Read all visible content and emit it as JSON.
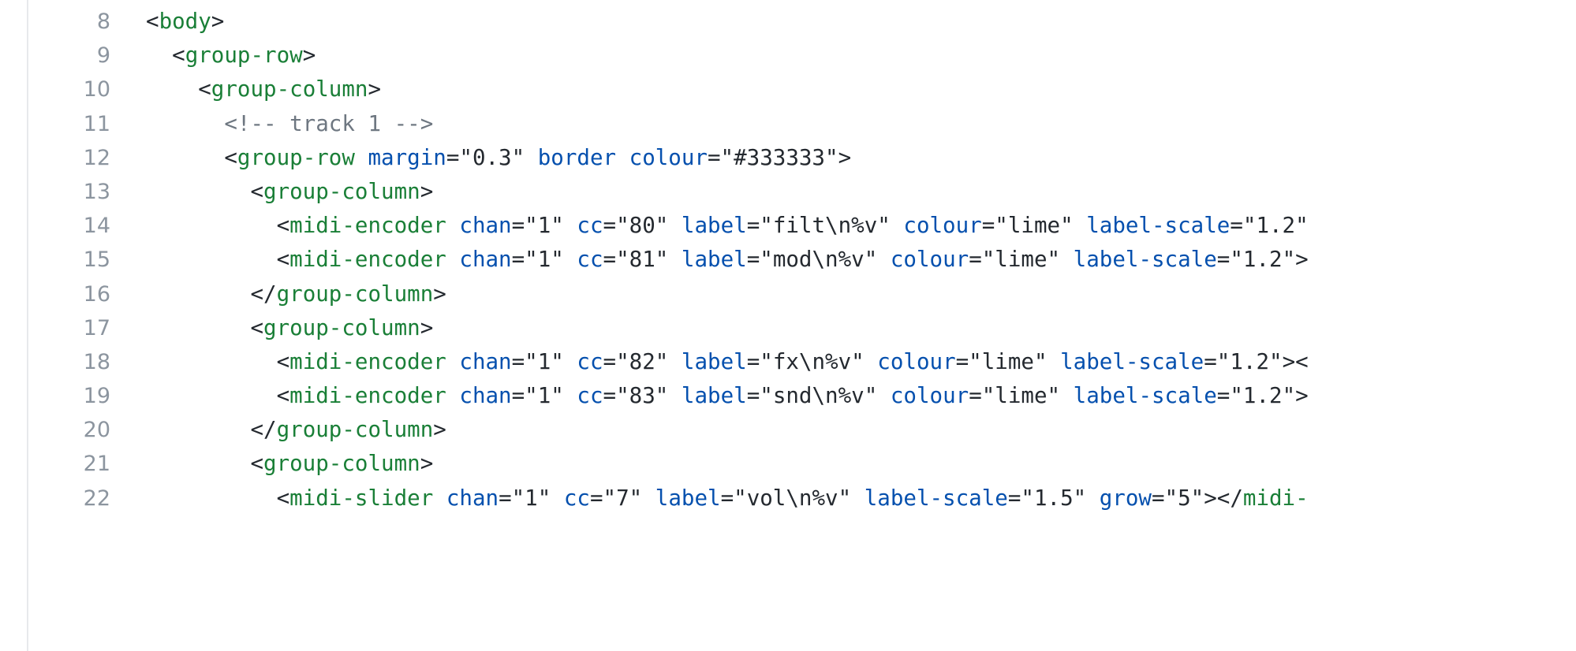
{
  "editor": {
    "language": "html",
    "first_line_number": 8,
    "colors": {
      "background": "#ffffff",
      "tag": "#1a7f37",
      "attribute": "#0550ae",
      "value": "#24292f",
      "comment": "#6e7781",
      "line_number": "#8c959f",
      "gutter_divider": "#e7e9ec"
    },
    "lines": [
      {
        "number": "8",
        "indent": 0,
        "text": "<body>",
        "tokens": [
          {
            "t": "punct",
            "s": "<"
          },
          {
            "t": "tag",
            "s": "body"
          },
          {
            "t": "punct",
            "s": ">"
          }
        ]
      },
      {
        "number": "9",
        "indent": 1,
        "text": "<group-row>",
        "tokens": [
          {
            "t": "punct",
            "s": "<"
          },
          {
            "t": "tag",
            "s": "group-row"
          },
          {
            "t": "punct",
            "s": ">"
          }
        ]
      },
      {
        "number": "10",
        "indent": 2,
        "text": "<group-column>",
        "tokens": [
          {
            "t": "punct",
            "s": "<"
          },
          {
            "t": "tag",
            "s": "group-column"
          },
          {
            "t": "punct",
            "s": ">"
          }
        ]
      },
      {
        "number": "11",
        "indent": 3,
        "text": "<!-- track 1 -->",
        "tokens": [
          {
            "t": "comment",
            "s": "<!-- track 1 -->"
          }
        ]
      },
      {
        "number": "12",
        "indent": 3,
        "text": "<group-row margin=\"0.3\" border colour=\"#333333\">",
        "tokens": [
          {
            "t": "punct",
            "s": "<"
          },
          {
            "t": "tag",
            "s": "group-row"
          },
          {
            "t": "plain",
            "s": " "
          },
          {
            "t": "attr",
            "s": "margin"
          },
          {
            "t": "val",
            "s": "=\"0.3\""
          },
          {
            "t": "plain",
            "s": " "
          },
          {
            "t": "attr",
            "s": "border"
          },
          {
            "t": "plain",
            "s": " "
          },
          {
            "t": "attr",
            "s": "colour"
          },
          {
            "t": "val",
            "s": "=\"#333333\""
          },
          {
            "t": "punct",
            "s": ">"
          }
        ]
      },
      {
        "number": "13",
        "indent": 4,
        "text": "<group-column>",
        "tokens": [
          {
            "t": "punct",
            "s": "<"
          },
          {
            "t": "tag",
            "s": "group-column"
          },
          {
            "t": "punct",
            "s": ">"
          }
        ]
      },
      {
        "number": "14",
        "indent": 5,
        "text": "<midi-encoder chan=\"1\" cc=\"80\" label=\"filt\\n%v\" colour=\"lime\" label-scale=\"1.2\"",
        "clipped": true,
        "tokens": [
          {
            "t": "punct",
            "s": "<"
          },
          {
            "t": "tag",
            "s": "midi-encoder"
          },
          {
            "t": "plain",
            "s": " "
          },
          {
            "t": "attr",
            "s": "chan"
          },
          {
            "t": "val",
            "s": "=\"1\""
          },
          {
            "t": "plain",
            "s": " "
          },
          {
            "t": "attr",
            "s": "cc"
          },
          {
            "t": "val",
            "s": "=\"80\""
          },
          {
            "t": "plain",
            "s": " "
          },
          {
            "t": "attr",
            "s": "label"
          },
          {
            "t": "val",
            "s": "=\"filt\\n%v\""
          },
          {
            "t": "plain",
            "s": " "
          },
          {
            "t": "attr",
            "s": "colour"
          },
          {
            "t": "val",
            "s": "=\"lime\""
          },
          {
            "t": "plain",
            "s": " "
          },
          {
            "t": "attr",
            "s": "label-scale"
          },
          {
            "t": "val",
            "s": "=\"1.2\""
          }
        ]
      },
      {
        "number": "15",
        "indent": 5,
        "text": "<midi-encoder chan=\"1\" cc=\"81\" label=\"mod\\n%v\" colour=\"lime\" label-scale=\"1.2\">",
        "clipped": true,
        "tokens": [
          {
            "t": "punct",
            "s": "<"
          },
          {
            "t": "tag",
            "s": "midi-encoder"
          },
          {
            "t": "plain",
            "s": " "
          },
          {
            "t": "attr",
            "s": "chan"
          },
          {
            "t": "val",
            "s": "=\"1\""
          },
          {
            "t": "plain",
            "s": " "
          },
          {
            "t": "attr",
            "s": "cc"
          },
          {
            "t": "val",
            "s": "=\"81\""
          },
          {
            "t": "plain",
            "s": " "
          },
          {
            "t": "attr",
            "s": "label"
          },
          {
            "t": "val",
            "s": "=\"mod\\n%v\""
          },
          {
            "t": "plain",
            "s": " "
          },
          {
            "t": "attr",
            "s": "colour"
          },
          {
            "t": "val",
            "s": "=\"lime\""
          },
          {
            "t": "plain",
            "s": " "
          },
          {
            "t": "attr",
            "s": "label-scale"
          },
          {
            "t": "val",
            "s": "=\"1.2\""
          },
          {
            "t": "punct",
            "s": ">"
          }
        ]
      },
      {
        "number": "16",
        "indent": 4,
        "text": "</group-column>",
        "tokens": [
          {
            "t": "punct",
            "s": "</"
          },
          {
            "t": "tag",
            "s": "group-column"
          },
          {
            "t": "punct",
            "s": ">"
          }
        ]
      },
      {
        "number": "17",
        "indent": 4,
        "text": "<group-column>",
        "tokens": [
          {
            "t": "punct",
            "s": "<"
          },
          {
            "t": "tag",
            "s": "group-column"
          },
          {
            "t": "punct",
            "s": ">"
          }
        ]
      },
      {
        "number": "18",
        "indent": 5,
        "text": "<midi-encoder chan=\"1\" cc=\"82\" label=\"fx\\n%v\" colour=\"lime\" label-scale=\"1.2\"><",
        "clipped": true,
        "tokens": [
          {
            "t": "punct",
            "s": "<"
          },
          {
            "t": "tag",
            "s": "midi-encoder"
          },
          {
            "t": "plain",
            "s": " "
          },
          {
            "t": "attr",
            "s": "chan"
          },
          {
            "t": "val",
            "s": "=\"1\""
          },
          {
            "t": "plain",
            "s": " "
          },
          {
            "t": "attr",
            "s": "cc"
          },
          {
            "t": "val",
            "s": "=\"82\""
          },
          {
            "t": "plain",
            "s": " "
          },
          {
            "t": "attr",
            "s": "label"
          },
          {
            "t": "val",
            "s": "=\"fx\\n%v\""
          },
          {
            "t": "plain",
            "s": " "
          },
          {
            "t": "attr",
            "s": "colour"
          },
          {
            "t": "val",
            "s": "=\"lime\""
          },
          {
            "t": "plain",
            "s": " "
          },
          {
            "t": "attr",
            "s": "label-scale"
          },
          {
            "t": "val",
            "s": "=\"1.2\""
          },
          {
            "t": "punct",
            "s": "><"
          }
        ]
      },
      {
        "number": "19",
        "indent": 5,
        "text": "<midi-encoder chan=\"1\" cc=\"83\" label=\"snd\\n%v\" colour=\"lime\" label-scale=\"1.2\">",
        "clipped": true,
        "tokens": [
          {
            "t": "punct",
            "s": "<"
          },
          {
            "t": "tag",
            "s": "midi-encoder"
          },
          {
            "t": "plain",
            "s": " "
          },
          {
            "t": "attr",
            "s": "chan"
          },
          {
            "t": "val",
            "s": "=\"1\""
          },
          {
            "t": "plain",
            "s": " "
          },
          {
            "t": "attr",
            "s": "cc"
          },
          {
            "t": "val",
            "s": "=\"83\""
          },
          {
            "t": "plain",
            "s": " "
          },
          {
            "t": "attr",
            "s": "label"
          },
          {
            "t": "val",
            "s": "=\"snd\\n%v\""
          },
          {
            "t": "plain",
            "s": " "
          },
          {
            "t": "attr",
            "s": "colour"
          },
          {
            "t": "val",
            "s": "=\"lime\""
          },
          {
            "t": "plain",
            "s": " "
          },
          {
            "t": "attr",
            "s": "label-scale"
          },
          {
            "t": "val",
            "s": "=\"1.2\""
          },
          {
            "t": "punct",
            "s": ">"
          }
        ]
      },
      {
        "number": "20",
        "indent": 4,
        "text": "</group-column>",
        "tokens": [
          {
            "t": "punct",
            "s": "</"
          },
          {
            "t": "tag",
            "s": "group-column"
          },
          {
            "t": "punct",
            "s": ">"
          }
        ]
      },
      {
        "number": "21",
        "indent": 4,
        "text": "<group-column>",
        "tokens": [
          {
            "t": "punct",
            "s": "<"
          },
          {
            "t": "tag",
            "s": "group-column"
          },
          {
            "t": "punct",
            "s": ">"
          }
        ]
      },
      {
        "number": "22",
        "indent": 5,
        "text": "<midi-slider chan=\"1\" cc=\"7\" label=\"vol\\n%v\" label-scale=\"1.5\" grow=\"5\"></midi-",
        "clipped": true,
        "tokens": [
          {
            "t": "punct",
            "s": "<"
          },
          {
            "t": "tag",
            "s": "midi-slider"
          },
          {
            "t": "plain",
            "s": " "
          },
          {
            "t": "attr",
            "s": "chan"
          },
          {
            "t": "val",
            "s": "=\"1\""
          },
          {
            "t": "plain",
            "s": " "
          },
          {
            "t": "attr",
            "s": "cc"
          },
          {
            "t": "val",
            "s": "=\"7\""
          },
          {
            "t": "plain",
            "s": " "
          },
          {
            "t": "attr",
            "s": "label"
          },
          {
            "t": "val",
            "s": "=\"vol\\n%v\""
          },
          {
            "t": "plain",
            "s": " "
          },
          {
            "t": "attr",
            "s": "label-scale"
          },
          {
            "t": "val",
            "s": "=\"1.5\""
          },
          {
            "t": "plain",
            "s": " "
          },
          {
            "t": "attr",
            "s": "grow"
          },
          {
            "t": "val",
            "s": "=\"5\""
          },
          {
            "t": "punct",
            "s": "></"
          },
          {
            "t": "tag",
            "s": "midi-"
          }
        ]
      }
    ]
  }
}
